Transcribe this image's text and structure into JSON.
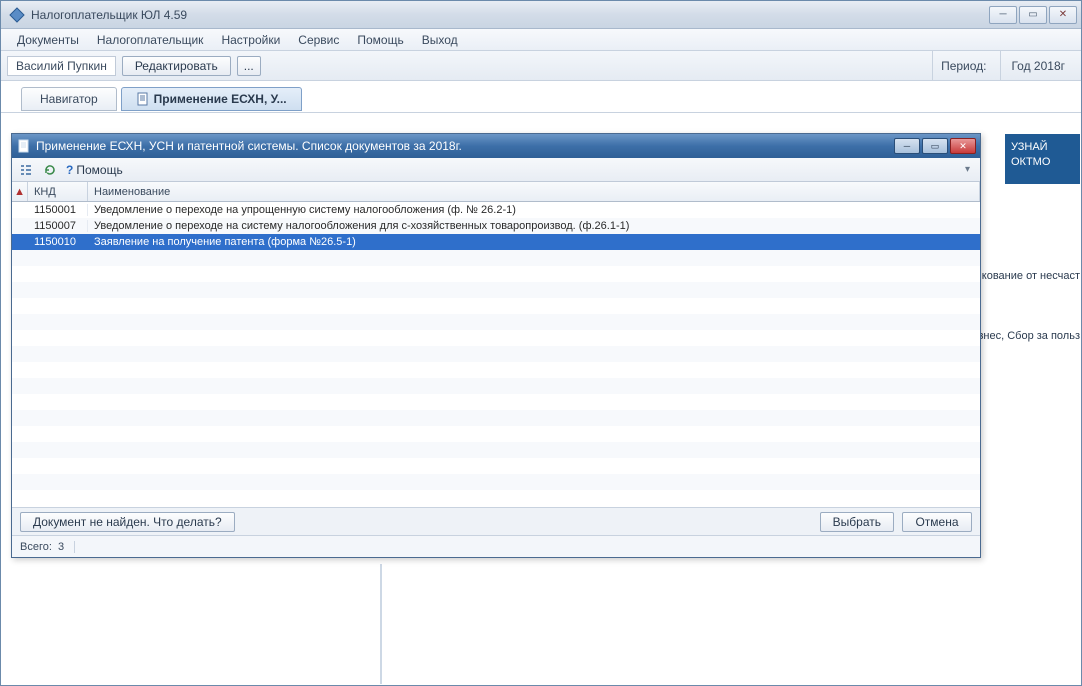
{
  "app": {
    "title": "Налогоплательщик ЮЛ 4.59"
  },
  "menu": {
    "docs": "Документы",
    "taxpayer": "Налогоплательщик",
    "settings": "Настройки",
    "service": "Сервис",
    "help": "Помощь",
    "exit": "Выход"
  },
  "toolbar": {
    "user": "Василий Пупкин",
    "edit": "Редактировать",
    "more": "...",
    "period_label": "Период:",
    "period_value": "Год 2018г"
  },
  "tabs": {
    "navigator": "Навигатор",
    "active": "Применение ЕСХН, У..."
  },
  "sidebar": {
    "oktmo1": "УЗНАЙ",
    "oktmo2": "ОКТМО"
  },
  "bg": {
    "line1": "кование от несчаст",
    "line2": "знес, Сбор за польз"
  },
  "child": {
    "title": "Применение ЕСХН, УСН и патентной системы. Список документов за 2018г.",
    "help": "Помощь",
    "columns": {
      "knd": "КНД",
      "name": "Наименование"
    },
    "rows": [
      {
        "knd": "1150001",
        "name": "Уведомление о переходе на упрощенную систему налогообложения (ф. № 26.2-1)",
        "selected": false
      },
      {
        "knd": "1150007",
        "name": "Уведомление  о переходе на систему налогообложения  для с-хозяйственных товаропроизвод. (ф.26.1-1)",
        "selected": false
      },
      {
        "knd": "1150010",
        "name": "Заявление на получение патента (форма №26.5-1)",
        "selected": true
      }
    ],
    "footer": {
      "notfound": "Документ не найден. Что делать?",
      "select": "Выбрать",
      "cancel": "Отмена"
    },
    "status": {
      "total_label": "Всего:",
      "total": "3"
    }
  }
}
